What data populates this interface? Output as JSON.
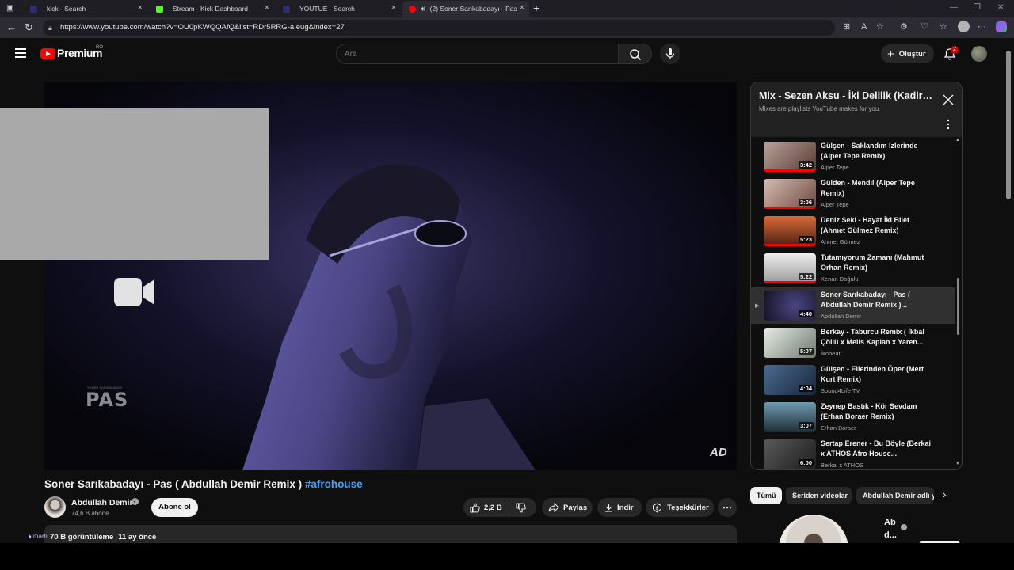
{
  "browser": {
    "tabs": [
      {
        "label": "kick - Search",
        "favicon_color": "#2d2d70"
      },
      {
        "label": "Stream - Kick Dashboard",
        "favicon_color": "#53fc18"
      },
      {
        "label": "YOUTUE - Search",
        "favicon_color": "#2d2d70"
      },
      {
        "label": "(2) Soner Sarıkabadayı - Pas",
        "favicon_color": "#ff0000"
      }
    ],
    "url": "https://www.youtube.com/watch?v=OU0pKWQQAfQ&list=RDr5RRG-aIeug&index=27"
  },
  "masthead": {
    "logo_text": "Premium",
    "country_code": "RO",
    "search_placeholder": "Ara",
    "create_label": "Oluştur",
    "notification_count": "2"
  },
  "player": {
    "logo_top_text": "SONER SARIKABADAYI",
    "logo_text": "PAS",
    "watermark": "AD"
  },
  "video": {
    "title": "Soner Sarıkabadayı - Pas ( Abdullah Demir Remix )",
    "hashtag": "#afrohouse",
    "channel_name": "Abdullah Demir",
    "subscribers": "74,6 B abone",
    "subscribe_label": "Abone ol",
    "likes": "2,2 B",
    "share_label": "Paylaş",
    "download_label": "İndir",
    "thanks_label": "Teşekkürler",
    "views": "70 B görüntüleme",
    "uploaded": "11 ay önce",
    "overlay_user": "marti"
  },
  "playlist": {
    "title": "Mix - Sezen Aksu - İki Delilik (Kadir Bulut Remix)",
    "subtitle": "Mixes are playlists YouTube makes for you",
    "items": [
      {
        "title": "Gülşen - Saklandım İzlerinde (Alper Tepe Remix)",
        "channel": "Alper Tepe",
        "duration": "3:42",
        "thumb": "#b7a39b",
        "progress": 1.0
      },
      {
        "title": "Gülden - Mendil (Alper Tepe Remix)",
        "channel": "Alper Tepe",
        "duration": "3:06",
        "thumb": "#c9b1a8",
        "progress": 1.0
      },
      {
        "title": "Deniz Seki - Hayat İki Bilet (Ahmet Gülmez Remix)",
        "channel": "Ahmet Gülmez",
        "duration": "5:23",
        "thumb": "#c75a2e",
        "progress": 1.0
      },
      {
        "title": "Tutamıyorum Zamanı (Mahmut Orhan Remix)",
        "channel": "Kenan Doğulu",
        "duration": "5:22",
        "thumb": "#d8d8d8",
        "progress": 1.0
      },
      {
        "title": "Soner Sarıkabadayı - Pas ( Abdullah Demir Remix )...",
        "channel": "Abdullah Demir",
        "duration": "4:40",
        "thumb": "#2a2740",
        "progress": 0,
        "current": true
      },
      {
        "title": "Berkay - Taburcu Remix ( İkbal Çöllü x Melis Kaplan x Yaren...",
        "channel": "İkobeat",
        "duration": "5:07",
        "thumb": "#cfd6cf",
        "progress": 0
      },
      {
        "title": "Gülşen - Ellerinden Öper (Mert Kurt Remix)",
        "channel": "Sound4Life TV",
        "duration": "4:04",
        "thumb": "#314a66",
        "progress": 0
      },
      {
        "title": "Zeynep Bastık - Kör Sevdam (Erhan Boraer Remix)",
        "channel": "Erhan Boraer",
        "duration": "3:07",
        "thumb": "#4a6e80",
        "progress": 0
      },
      {
        "title": "Sertap Erener - Bu Böyle (Berkai x ATHOS Afro House...",
        "channel": "Berkai x ATHOS",
        "duration": "6:00",
        "thumb": "#3e3e3e",
        "progress": 0
      }
    ],
    "playing_indicator": "▶"
  },
  "chips": [
    "Tümü",
    "Seriden videolar",
    "Abdullah Demir adlı yükleyiciden"
  ],
  "recommendation": {
    "title": "Ab d..."
  },
  "colors": {
    "accent": "#ff0000",
    "link": "#3ea6ff",
    "background": "#0f0f0f"
  }
}
